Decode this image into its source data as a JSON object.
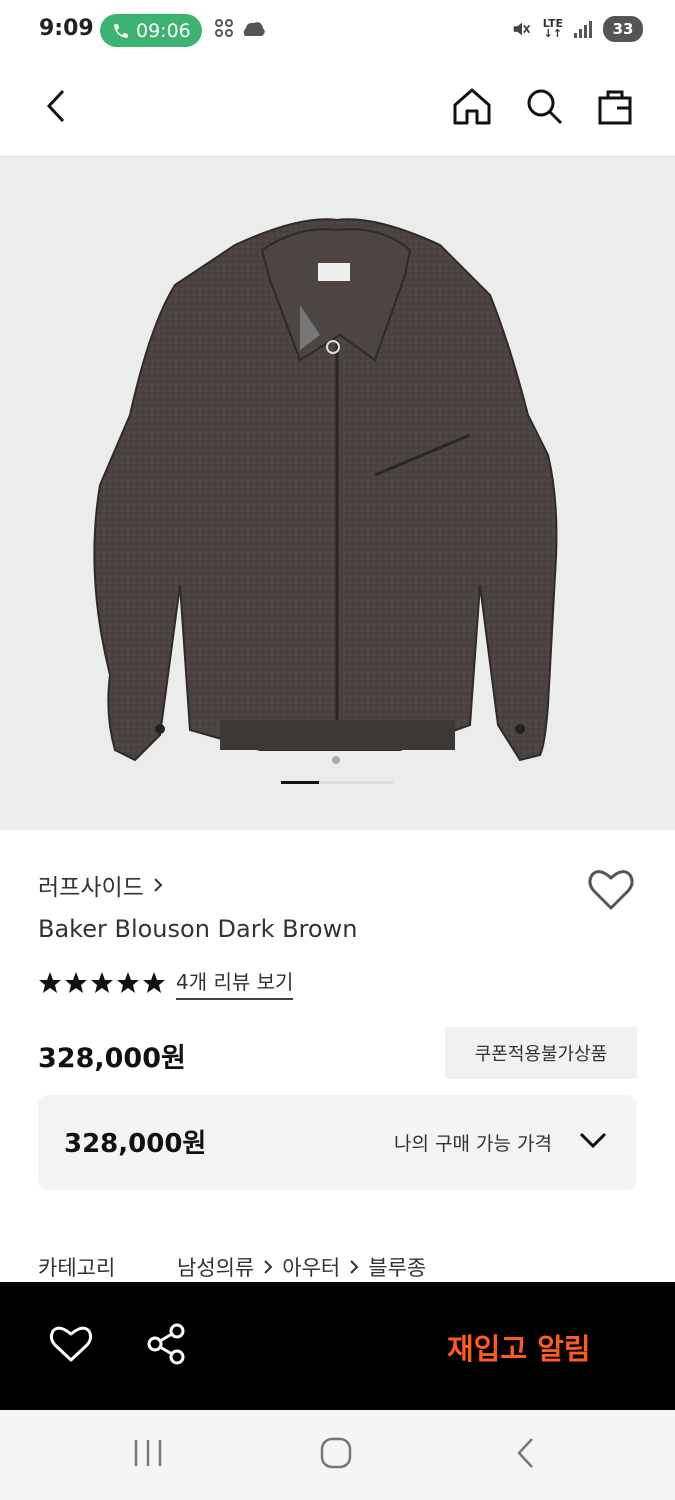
{
  "status_bar": {
    "time": "9:09",
    "call_time": "09:06",
    "battery": "33",
    "network": "LTE"
  },
  "icons": {
    "back": "back-arrow-icon",
    "home": "home-icon",
    "search": "search-icon",
    "cart": "shopping-bag-icon",
    "wishlist": "heart-outline-icon",
    "share": "share-icon",
    "expand": "chevron-down-icon"
  },
  "product": {
    "brand": "러프사이드",
    "name": "Baker Blouson Dark Brown",
    "rating_stars": 5,
    "review_link": "4개 리뷰 보기",
    "price": "328,000원",
    "coupon_badge": "쿠폰적용불가상품",
    "my_price": "328,000원",
    "my_price_label": "나의 구매 가능 가격",
    "image_label": "rough side",
    "image_indicator": "1 of 3"
  },
  "category": {
    "label": "카테고리",
    "path": [
      "남성의류",
      "아우터",
      "블루종"
    ]
  },
  "action_bar": {
    "restock_label": "재입고 알림"
  },
  "colors": {
    "accent": "#ff5a1f",
    "call_green": "#3cb371",
    "jacket": "#4a4340",
    "hero_bg": "#ececec"
  }
}
